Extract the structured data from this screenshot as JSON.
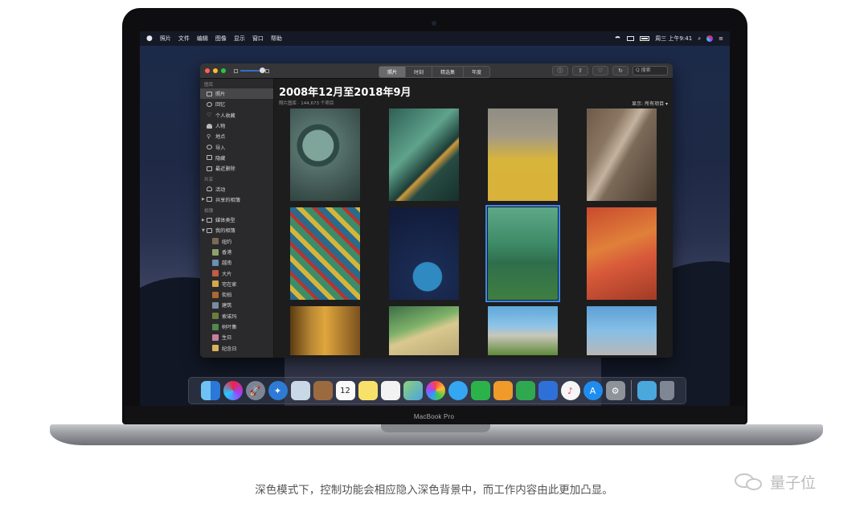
{
  "menubar": {
    "apple": "",
    "items": [
      "照片",
      "文件",
      "编辑",
      "图像",
      "显示",
      "窗口",
      "帮助"
    ],
    "clock": "周三 上午9:41"
  },
  "toolbar": {
    "tabs": [
      "照片",
      "时刻",
      "精选集",
      "年度"
    ],
    "active_tab": "照片",
    "info": "ⓘ",
    "search_placeholder": "Q 搜索"
  },
  "sidebar": {
    "sections": [
      {
        "title": "图库",
        "items": [
          {
            "label": "照片",
            "icon": "photos-icon",
            "selected": true
          },
          {
            "label": "回忆",
            "icon": "memories-icon"
          },
          {
            "label": "个人收藏",
            "icon": "heart-icon"
          },
          {
            "label": "人物",
            "icon": "person-icon"
          },
          {
            "label": "地点",
            "icon": "pin-icon"
          },
          {
            "label": "导入",
            "icon": "import-icon"
          },
          {
            "label": "隐藏",
            "icon": "hidden-icon"
          },
          {
            "label": "最近删除",
            "icon": "trash-icon"
          }
        ]
      },
      {
        "title": "共享",
        "items": [
          {
            "label": "活动",
            "icon": "cloud-icon"
          },
          {
            "label": "共享的相簿",
            "icon": "folder-icon",
            "collapsed": true
          }
        ]
      },
      {
        "title": "相簿",
        "items": [
          {
            "label": "媒体类型",
            "icon": "folder-icon",
            "collapsed": true
          },
          {
            "label": "我的相簿",
            "icon": "folder-icon",
            "expanded": true
          }
        ]
      }
    ],
    "albums": [
      "纽约",
      "香港",
      "越南",
      "大片",
      "宅在家",
      "街拍",
      "建筑",
      "索诺玛",
      "树叶集",
      "生日",
      "纪念日"
    ]
  },
  "main": {
    "title": "2008年12月至2018年9月",
    "subtitle": "照片图库 · 144,673 个项目",
    "show_label": "显示: 所有项目 ▾"
  },
  "dock": {
    "apps": [
      "finder-icon",
      "siri-icon",
      "launchpad-icon",
      "safari-icon",
      "mail-icon",
      "contacts-icon",
      "calendar-icon",
      "notes-icon",
      "reminders-icon",
      "maps-icon",
      "photos-icon",
      "messages-icon",
      "facetime-icon",
      "pages-icon",
      "numbers-icon",
      "keynote-icon",
      "itunes-icon",
      "app-store-icon",
      "system-preferences-icon",
      "downloads-icon",
      "trash-icon"
    ],
    "calendar_day": "12"
  },
  "device_label": "MacBook Pro",
  "caption": "深色模式下，控制功能会相应隐入深色背景中，而工作内容由此更加凸显。",
  "watermark": "量子位"
}
